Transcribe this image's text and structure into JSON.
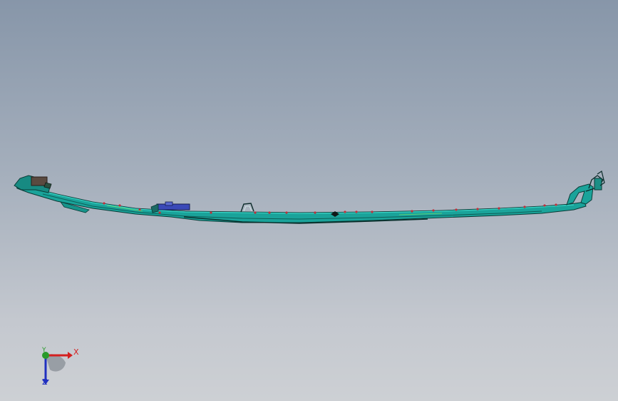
{
  "viewport": {
    "background_top": "#8796a9",
    "background_bottom": "#cdd0d4"
  },
  "model": {
    "icon": "cad-part-rail",
    "color_primary": "#1aa39a",
    "color_edges": "#0a3a36",
    "color_highlight": "#3ad6c8",
    "color_points": "#c0303a",
    "color_clip": "#3a49b8"
  },
  "triad": {
    "x_label": "X",
    "y_label": "Y",
    "z_label": "Z",
    "x_color": "#d42020",
    "y_color": "#2a9a2a",
    "z_color": "#2030c0"
  }
}
